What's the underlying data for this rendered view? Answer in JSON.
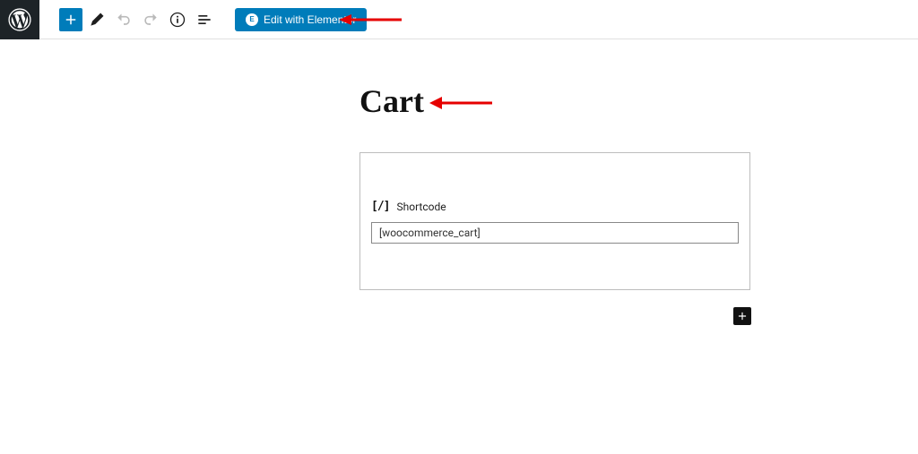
{
  "toolbar": {
    "elementor_label": "Edit with Elementor",
    "elementor_badge": "E"
  },
  "page": {
    "title": "Cart"
  },
  "block": {
    "shortcode_icon": "[/]",
    "shortcode_label": "Shortcode",
    "shortcode_value": "[woocommerce_cart]"
  }
}
